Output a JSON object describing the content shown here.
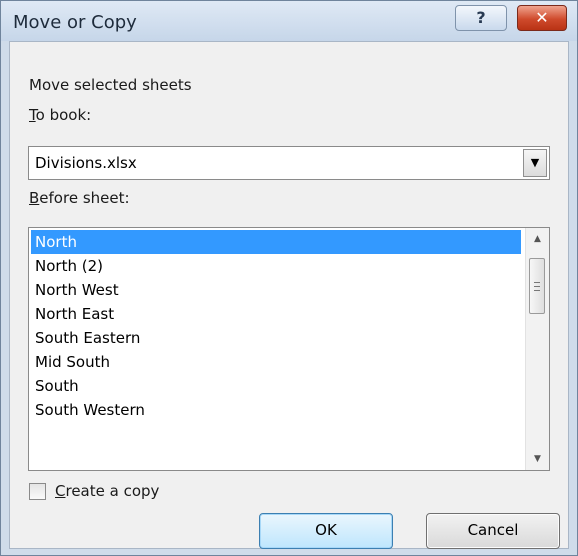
{
  "window": {
    "title": "Move or Copy",
    "help_glyph": "?",
    "close_glyph": "✕"
  },
  "dialog": {
    "heading": "Move selected sheets",
    "to_book_label_key": "T",
    "to_book_label_rest": "o book:",
    "to_book_value": "Divisions.xlsx",
    "before_sheet_label_key": "B",
    "before_sheet_label_rest": "efore sheet:",
    "sheets": [
      "North",
      "North (2)",
      "North West",
      "North East",
      "South Eastern",
      "Mid South",
      "South",
      "South Western"
    ],
    "selected_sheet": "North",
    "create_copy_label_key": "C",
    "create_copy_label_rest": "reate a copy",
    "create_copy_checked": false,
    "ok_label": "OK",
    "cancel_label": "Cancel"
  },
  "icons": {
    "combo_arrow": "chevron-down-icon",
    "scroll_up": "arrow-up-icon",
    "scroll_down": "arrow-down-icon"
  },
  "colors": {
    "selection": "#3399ff",
    "title_bar": "#cfdcea",
    "close_button": "#cf4a2c"
  }
}
